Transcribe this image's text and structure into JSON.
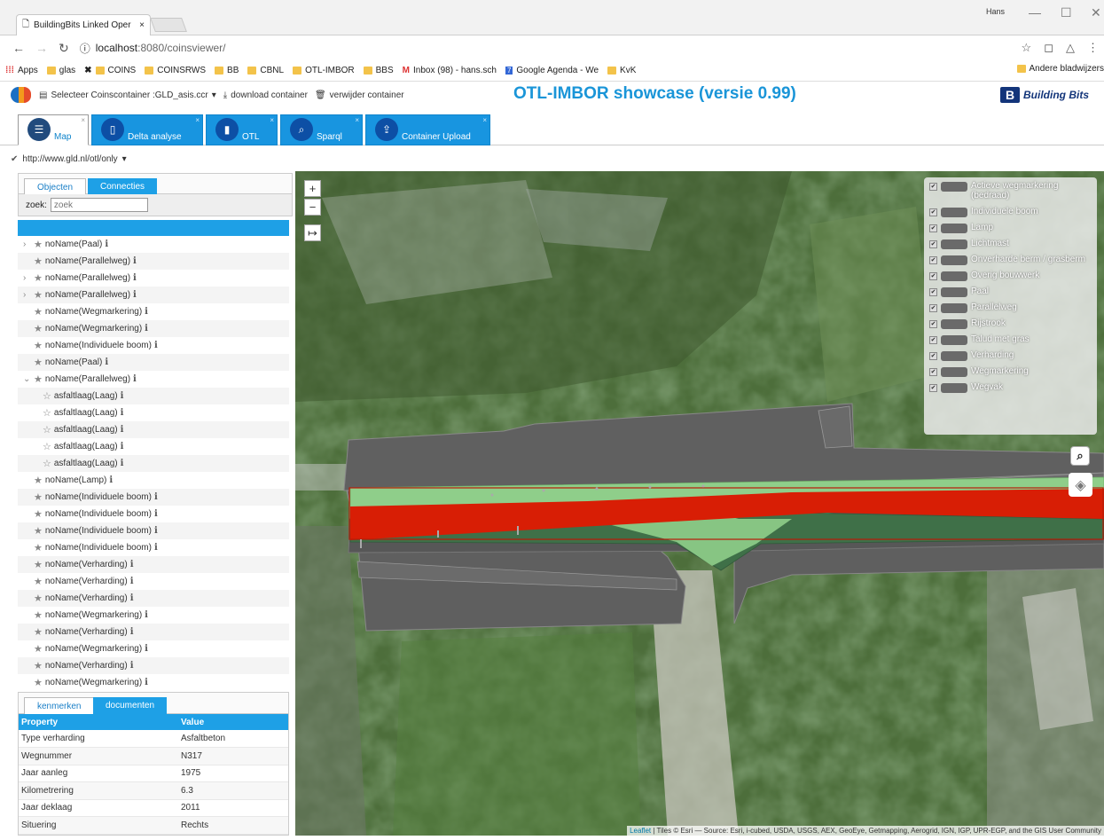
{
  "browser": {
    "tab_title": "BuildingBits Linked Oper",
    "tab_close": "×",
    "window_user": "Hans",
    "url_host": "localhost",
    "url_path": ":8080/coinsviewer/",
    "bookmarks": [
      "Apps",
      "glas",
      "COINS",
      "COINSRWS",
      "BB",
      "CBNL",
      "OTL-IMBOR",
      "BBS",
      "Inbox (98) - hans.sch",
      "Google Agenda - We",
      "KvK"
    ],
    "other_bookmarks": "Andere bladwijzers"
  },
  "app": {
    "container_label": "Selecteer Coinscontainer :GLD_asis.ccr",
    "download": "download container",
    "remove": "verwijder container",
    "title": "OTL-IMBOR showcase (versie 0.99)",
    "brand": "Building Bits",
    "tabs": [
      "Map",
      "Delta analyse",
      "OTL",
      "Sparql",
      "Container Upload"
    ],
    "graph": "http://www.gld.nl/otl/only"
  },
  "left": {
    "tabs": [
      "Objecten",
      "Connecties"
    ],
    "search_label": "zoek:",
    "search_placeholder": "zoek",
    "tree": [
      {
        "label": "noName(Paal)",
        "chev": "›",
        "child": false
      },
      {
        "label": "noName(Parallelweg)",
        "chev": "",
        "child": false
      },
      {
        "label": "noName(Parallelweg)",
        "chev": "›",
        "child": false
      },
      {
        "label": "noName(Parallelweg)",
        "chev": "›",
        "child": false
      },
      {
        "label": "noName(Wegmarkering)",
        "chev": "",
        "child": false
      },
      {
        "label": "noName(Wegmarkering)",
        "chev": "",
        "child": false
      },
      {
        "label": "noName(Individuele boom)",
        "chev": "",
        "child": false
      },
      {
        "label": "noName(Paal)",
        "chev": "",
        "child": false
      },
      {
        "label": "noName(Parallelweg)",
        "chev": "⌄",
        "child": false
      },
      {
        "label": "asfaltlaag(Laag)",
        "chev": "",
        "child": true
      },
      {
        "label": "asfaltlaag(Laag)",
        "chev": "",
        "child": true
      },
      {
        "label": "asfaltlaag(Laag)",
        "chev": "",
        "child": true
      },
      {
        "label": "asfaltlaag(Laag)",
        "chev": "",
        "child": true
      },
      {
        "label": "asfaltlaag(Laag)",
        "chev": "",
        "child": true
      },
      {
        "label": "noName(Lamp)",
        "chev": "",
        "child": false
      },
      {
        "label": "noName(Individuele boom)",
        "chev": "",
        "child": false
      },
      {
        "label": "noName(Individuele boom)",
        "chev": "",
        "child": false
      },
      {
        "label": "noName(Individuele boom)",
        "chev": "",
        "child": false
      },
      {
        "label": "noName(Individuele boom)",
        "chev": "",
        "child": false
      },
      {
        "label": "noName(Verharding)",
        "chev": "",
        "child": false
      },
      {
        "label": "noName(Verharding)",
        "chev": "",
        "child": false
      },
      {
        "label": "noName(Verharding)",
        "chev": "",
        "child": false
      },
      {
        "label": "noName(Wegmarkering)",
        "chev": "",
        "child": false
      },
      {
        "label": "noName(Verharding)",
        "chev": "",
        "child": false
      },
      {
        "label": "noName(Wegmarkering)",
        "chev": "",
        "child": false
      },
      {
        "label": "noName(Verharding)",
        "chev": "",
        "child": false
      },
      {
        "label": "noName(Wegmarkering)",
        "chev": "",
        "child": false
      }
    ],
    "prop_tabs": [
      "kenmerken",
      "documenten"
    ],
    "prop_headers": [
      "Property",
      "Value"
    ],
    "props": [
      [
        "Type verharding",
        "Asfaltbeton"
      ],
      [
        "Wegnummer",
        "N317"
      ],
      [
        "Jaar aanleg",
        "1975"
      ],
      [
        "Kilometrering",
        "6.3"
      ],
      [
        "Jaar deklaag",
        "2011"
      ],
      [
        "Situering",
        "Rechts"
      ]
    ]
  },
  "map": {
    "zoom_in": "+",
    "zoom_out": "−",
    "extent": "↦",
    "legend": [
      "Actieve wegmarkering (bedraad)",
      "Individuele boom",
      "Lamp",
      "Lichtmast",
      "Onverharde berm / grasberm",
      "Overig bouwwerk",
      "Paal",
      "Parallelweg",
      "Rijstrook",
      "Talud met gras",
      "Verharding",
      "Wegmarkering",
      "Wegvak"
    ],
    "attribution_link": "Leaflet",
    "attribution": " | Tiles © Esri — Source: Esri, i-cubed, USDA, USGS, AEX, GeoEye, Getmapping, Aerogrid, IGN, IGP, UPR-EGP, and the GIS User Community",
    "colors": {
      "selected": "#d81e05",
      "road": "#5f5f5f",
      "grass_light": "#8fce8a",
      "grass_dark": "#3f7048"
    }
  }
}
